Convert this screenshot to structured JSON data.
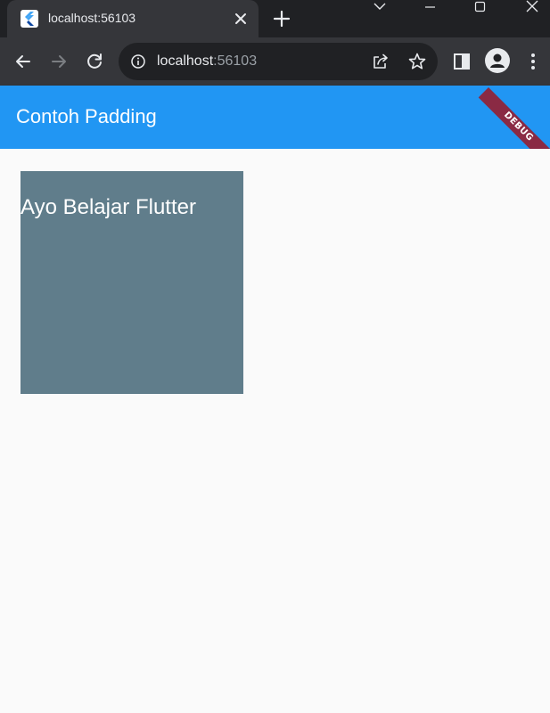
{
  "browser": {
    "tab": {
      "title": "localhost:56103",
      "favicon": "flutter-icon"
    },
    "window_controls": [
      "tab-search-icon",
      "minimize-icon",
      "maximize-icon",
      "close-window-icon"
    ],
    "toolbar": {
      "url_host": "localhost",
      "url_port": ":56103",
      "icons": [
        "back-arrow-icon",
        "forward-arrow-icon",
        "reload-icon",
        "site-info-icon",
        "share-icon",
        "star-icon",
        "side-panel-icon",
        "profile-icon",
        "menu-dots-icon"
      ]
    },
    "colors": {
      "tabstrip": "#202124",
      "toolbar": "#35363a"
    }
  },
  "app": {
    "title": "Contoh Padding",
    "debug_banner": "DEBUG",
    "container_text": "Ayo Belajar Flutter",
    "colors": {
      "appbar": "#2196f3",
      "container": "#607d8b",
      "background": "#fafafa",
      "banner": "#8a2a44"
    }
  }
}
